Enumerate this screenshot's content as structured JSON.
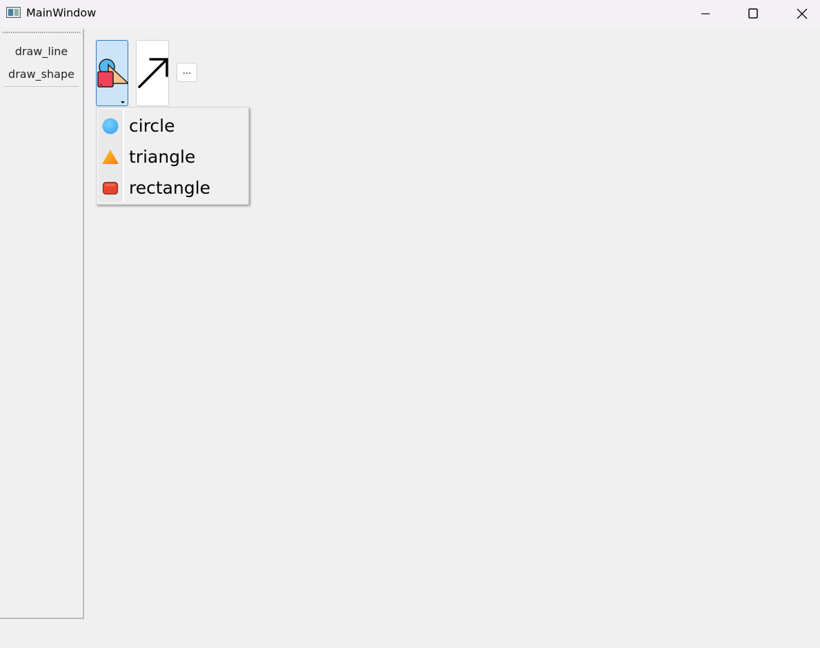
{
  "window": {
    "title": "MainWindow",
    "icon": "app-window-icon",
    "controls": {
      "minimize_icon": "minimize-icon",
      "maximize_icon": "maximize-icon",
      "close_icon": "close-icon"
    }
  },
  "dock": {
    "items": [
      {
        "label": "draw_line"
      },
      {
        "label": "draw_shape"
      }
    ]
  },
  "toolbar": {
    "shape_tool_icon": "shapes-icon",
    "arrow_tool_icon": "arrow-up-right-icon",
    "more_label": "..."
  },
  "shape_menu": {
    "items": [
      {
        "label": "circle",
        "icon": "circle-icon",
        "color": "#55b8f5"
      },
      {
        "label": "triangle",
        "icon": "triangle-icon",
        "color": "#f7a21b"
      },
      {
        "label": "rectangle",
        "icon": "rectangle-icon",
        "color": "#e8442f"
      }
    ]
  },
  "colors": {
    "active_tool_bg": "#cce4f7",
    "active_tool_border": "#2a76c6",
    "window_bg": "#f0f0f0"
  }
}
